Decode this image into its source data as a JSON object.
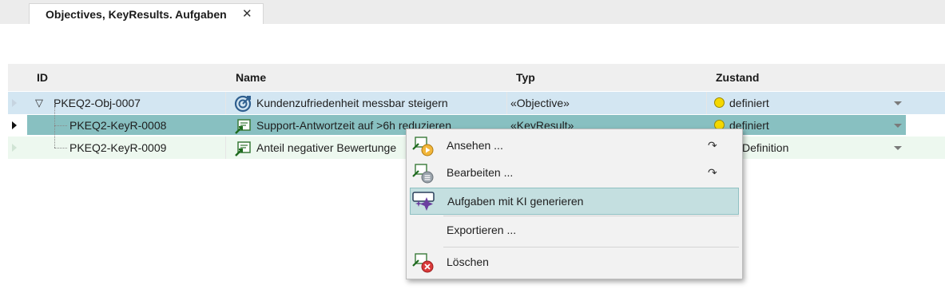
{
  "tab": {
    "title": "Objectives, KeyResults. Aufgaben",
    "close": "✕"
  },
  "table": {
    "columns": [
      "ID",
      "Name",
      "Typ",
      "Zustand"
    ],
    "rows": [
      {
        "expander": "▽",
        "id": "PKEQ2-Obj-0007",
        "name": "Kundenzufriedenheit messbar steigern",
        "typ": "«Objective»",
        "zustand": "definiert",
        "icon": "objective-target-icon"
      },
      {
        "id": "PKEQ2-KeyR-0008",
        "name": "Support-Antwortzeit auf >6h reduzieren",
        "typ": "«KeyResult»",
        "zustand": "definiert",
        "icon": "keyresult-icon"
      },
      {
        "id": "PKEQ2-KeyR-0009",
        "name": "Anteil negativer Bewertunge",
        "typ": "",
        "zustand": "Definition",
        "icon": "keyresult-icon"
      }
    ]
  },
  "context_menu": {
    "items": [
      {
        "label": "Ansehen ...",
        "submenu_symbol": "↷",
        "icon": "view-icon"
      },
      {
        "label": "Bearbeiten ...",
        "submenu_symbol": "↷",
        "icon": "edit-icon"
      },
      {
        "label": "Aufgaben mit KI generieren",
        "icon": "ai-sparkle-icon",
        "highlighted": true
      },
      {
        "label": "Exportieren ..."
      },
      {
        "label": "Löschen",
        "icon": "delete-icon"
      }
    ]
  },
  "colors": {
    "selected_row": "#88c0c1",
    "row1_bg": "#d3e6f2",
    "row3_bg": "#edf8ef",
    "status_yellow": "#f5d800",
    "menu_highlight": "#c4dfe0"
  }
}
